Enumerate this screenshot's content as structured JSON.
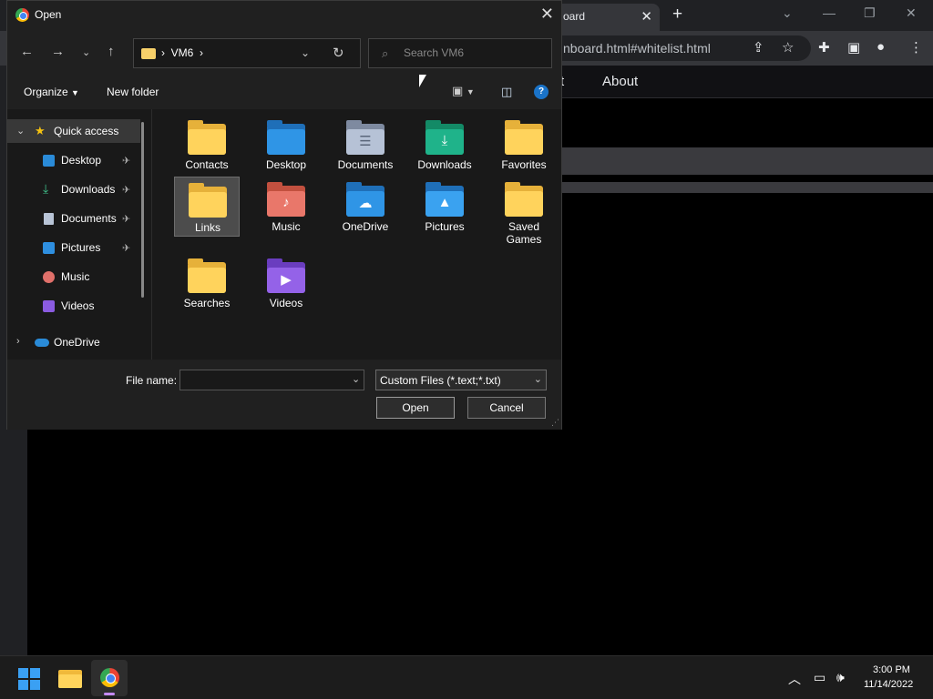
{
  "browser": {
    "tab_title": "oard",
    "url": "nboard.html#whitelist.html",
    "nav_about": "About",
    "nav_partial": "t",
    "tab_close": "✕",
    "new_tab": "+"
  },
  "dialog": {
    "title": "Open",
    "close": "✕",
    "address": [
      "VM6"
    ],
    "address_sep": "›",
    "search_placeholder": "Search VM6",
    "organize_label": "Organize",
    "new_folder_label": "New folder",
    "help_label": "?",
    "nav_items": [
      {
        "label": "Quick access",
        "icon": "star-icon",
        "expand": "expanded"
      },
      {
        "label": "Desktop",
        "icon": "desktop-icon",
        "pinned": true
      },
      {
        "label": "Downloads",
        "icon": "download-icon",
        "pinned": true
      },
      {
        "label": "Documents",
        "icon": "documents-icon",
        "pinned": true
      },
      {
        "label": "Pictures",
        "icon": "pictures-icon",
        "pinned": true
      },
      {
        "label": "Music",
        "icon": "music-icon",
        "pinned": false
      },
      {
        "label": "Videos",
        "icon": "videos-icon",
        "pinned": false
      },
      {
        "label": "OneDrive",
        "icon": "onedrive-icon",
        "expand": "collapsed"
      }
    ],
    "files": [
      {
        "name": "Contacts",
        "icon": "folder-icon",
        "selected": false
      },
      {
        "name": "Desktop",
        "icon": "desktop-folder-icon",
        "selected": false
      },
      {
        "name": "Documents",
        "icon": "documents-folder-icon",
        "selected": false
      },
      {
        "name": "Downloads",
        "icon": "downloads-folder-icon",
        "selected": false
      },
      {
        "name": "Favorites",
        "icon": "folder-icon",
        "selected": false
      },
      {
        "name": "Links",
        "icon": "folder-icon",
        "selected": true
      },
      {
        "name": "Music",
        "icon": "music-folder-icon",
        "selected": false
      },
      {
        "name": "OneDrive",
        "icon": "onedrive-folder-icon",
        "selected": false
      },
      {
        "name": "Pictures",
        "icon": "pictures-folder-icon",
        "selected": false
      },
      {
        "name": "Saved Games",
        "icon": "folder-icon",
        "selected": false
      },
      {
        "name": "Searches",
        "icon": "folder-icon",
        "selected": false
      },
      {
        "name": "Videos",
        "icon": "videos-folder-icon",
        "selected": false
      }
    ],
    "file_name_label": "File name:",
    "file_name_value": "",
    "filter_value": "Custom Files (*.text;*.txt)",
    "open_label": "Open",
    "cancel_label": "Cancel"
  },
  "taskbar": {
    "time": "3:00 PM",
    "date": "11/14/2022"
  },
  "colors": {
    "accent": "#1a73c8",
    "folder": "#ffd35c",
    "selection": "#4c4c4c"
  }
}
